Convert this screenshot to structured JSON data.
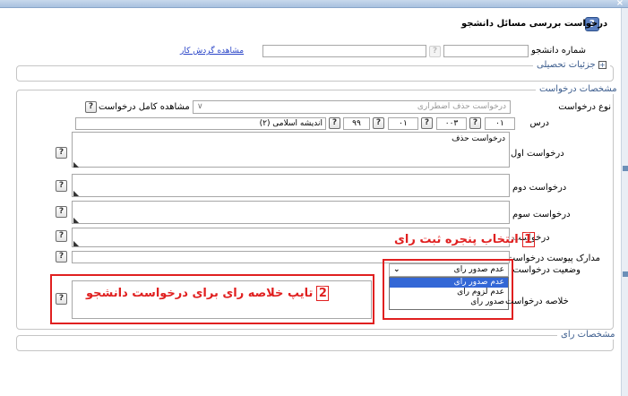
{
  "window": {
    "title": "درخواست بررسی مسائل دانشجو",
    "close_glyph": "×",
    "help_glyph": "?"
  },
  "student": {
    "number_label": "شماره دانشجو",
    "number_value": "",
    "name_value": "",
    "history_link": "مشاهده گردش کار"
  },
  "sections": {
    "academic_details": "جزئیات تحصیلی",
    "request_specs": "مشخصات درخواست",
    "opinion_specs": "مشخصات رای",
    "expand_glyph": "+"
  },
  "form": {
    "request_type_label": "نوع درخواست",
    "request_type_value": "درخواست حذف اضطراری",
    "request_type_chevron": "∨",
    "view_full_label": "مشاهده کامل درخواست",
    "course_label": "درس",
    "course_fields": [
      "۰۱",
      "۰۰۳",
      "۰۱",
      "۹۹"
    ],
    "course_name": "اندیشه اسلامی (۲)",
    "first_request_label": "درخواست اول",
    "first_request_value": "درخواست حذف",
    "second_request_label": "درخواست دوم",
    "third_request_label": "درخواست سوم",
    "fourth_request_label": "درخواست",
    "attachments_label": "مدارک پیوست درخواست",
    "status_label": "وضعیت درخواست",
    "summary_label": "خلاصه درخواست",
    "q_glyph": "?",
    "grip_glyph": "◣"
  },
  "status_dropdown": {
    "selected": "عدم صدور رای",
    "chevron": "⌄",
    "options": [
      "عدم صدور رای",
      "عدم لزوم رای",
      "صدور رای"
    ],
    "highlighted_index": 0
  },
  "annotations": {
    "step1_text": "انتخاب پنجره ثبت رای",
    "step1_num": "1",
    "step2_text": "تایپ خلاصه رای برای درخواست دانشجو",
    "step2_num": "2"
  },
  "colors": {
    "annotation_red": "#e02020",
    "highlight_blue": "#3367d6",
    "legend_blue": "#3b5c8d"
  }
}
